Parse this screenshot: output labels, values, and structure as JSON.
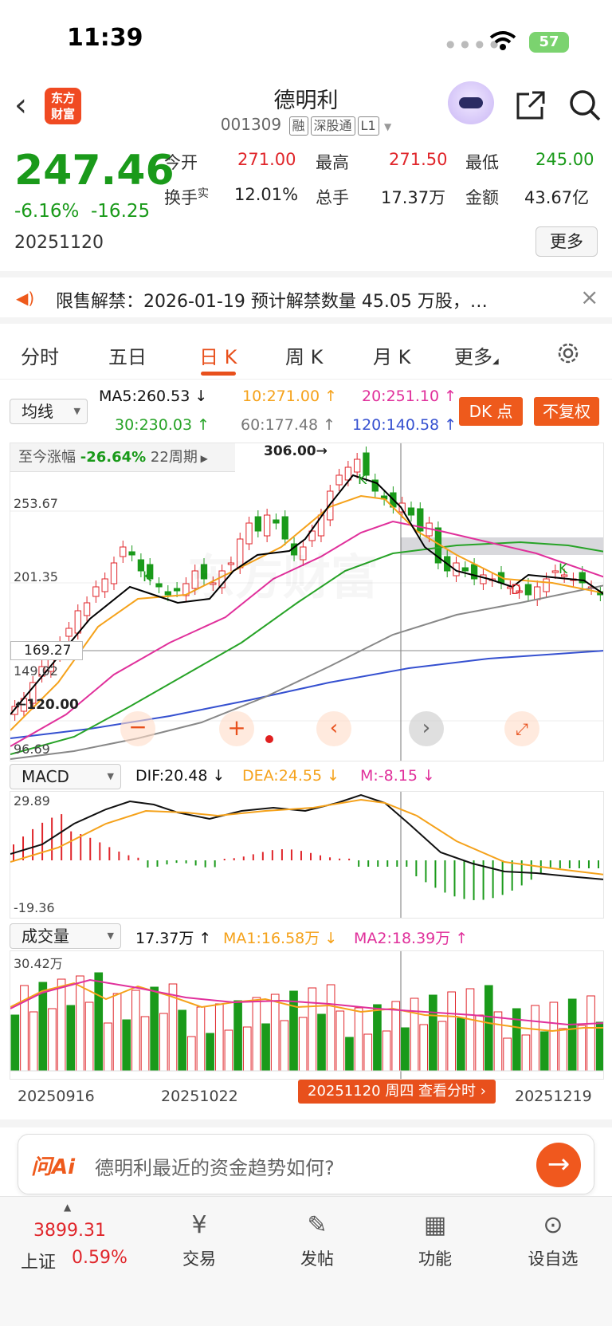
{
  "status": {
    "time": "11:39",
    "battery": "57"
  },
  "header": {
    "title": "德明利",
    "code": "001309",
    "tags": [
      "融",
      "深股通",
      "L1"
    ],
    "logo_top": "东方",
    "logo_bottom": "财富"
  },
  "quote": {
    "price": "247.46",
    "change_pct": "-6.16%",
    "change": "-16.25",
    "date": "20251120",
    "open_label": "今开",
    "open": "271.00",
    "high_label": "最高",
    "high": "271.50",
    "low_label": "最低",
    "low": "245.00",
    "turnover_label": "换手",
    "turnover_sup": "实",
    "turnover": "12.01%",
    "volume_label": "总手",
    "volume": "17.37万",
    "amount_label": "金额",
    "amount": "43.67亿",
    "more": "更多"
  },
  "notice": {
    "text": "限售解禁：2026-01-19 预计解禁数量 45.05 万股，…",
    "close": "×"
  },
  "tabs": [
    {
      "label": "分时"
    },
    {
      "label": "五日"
    },
    {
      "label": "日 K"
    },
    {
      "label": "周 K"
    },
    {
      "label": "月 K"
    },
    {
      "label": "更多"
    }
  ],
  "ma": {
    "selector": "均线",
    "ma5": "MA5:260.53 ↓",
    "ma10": "10:271.00 ↑",
    "ma20": "20:251.10 ↑",
    "ma30": "30:230.03 ↑",
    "ma60": "60:177.48 ↑",
    "ma120": "120:140.58 ↑",
    "dk": "DK 点",
    "fq": "不复权"
  },
  "kchart": {
    "period_label": "至今涨幅",
    "period_pct": "-26.64%",
    "period_n": "22周期",
    "high_mark": "306.00",
    "low_mark": "120.00",
    "cursor_price": "169.27",
    "y_ticks": [
      "253.67",
      "201.35",
      "149.02",
      "96.69"
    ],
    "watermark": "东方财富",
    "k_marks": [
      "K",
      "K",
      "K",
      "D"
    ],
    "colors": {
      "up": "#e0262b",
      "down": "#1a9a1a",
      "ma5": "#000000",
      "ma10": "#f5a21b",
      "ma20": "#e0309b",
      "ma30": "#27a327",
      "ma60": "#888888",
      "ma120": "#3550d0"
    }
  },
  "macd": {
    "selector": "MACD",
    "dif": "DIF:20.48 ↓",
    "dea": "DEA:24.55 ↓",
    "m": "M:-8.15 ↓",
    "top": "29.89",
    "bottom": "-19.36"
  },
  "volume": {
    "selector": "成交量",
    "value": "17.37万 ↑",
    "ma1": "MA1:16.58万 ↓",
    "ma2": "MA2:18.39万 ↑",
    "top": "30.42万"
  },
  "x_axis": [
    "20250916",
    "20251022",
    "20251219"
  ],
  "cursor_tip": "20251120 周四 查看分时",
  "ai": {
    "logo": "问Ai",
    "placeholder": "德明利最近的资金趋势如何?"
  },
  "nav": {
    "index_value": "3899.31",
    "index_name": "上证",
    "index_pct": "0.59%",
    "items": [
      {
        "label": "交易"
      },
      {
        "label": "发帖"
      },
      {
        "label": "功能"
      },
      {
        "label": "设自选"
      }
    ]
  }
}
